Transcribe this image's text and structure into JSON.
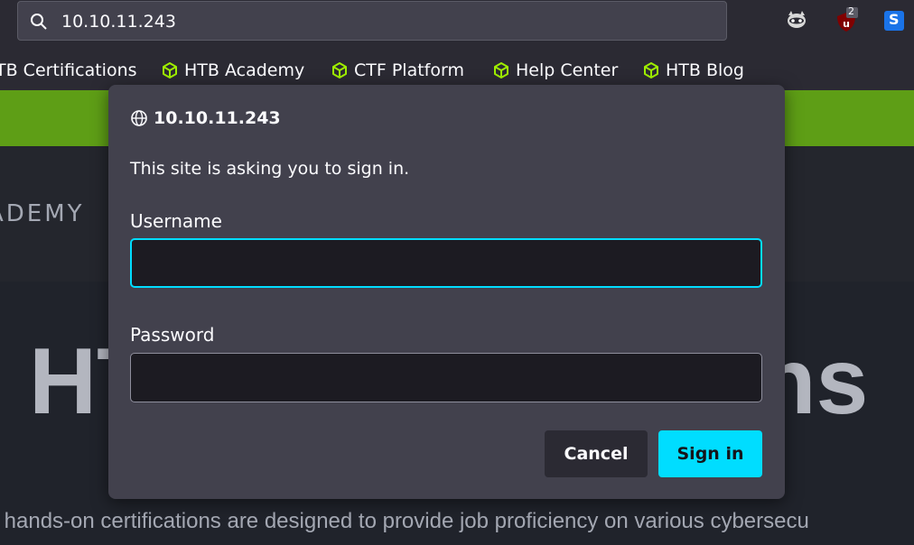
{
  "browser": {
    "url": "10.10.11.243",
    "extensions": [
      {
        "name": "raccoon-extension-icon"
      },
      {
        "name": "ublock-origin-icon",
        "badge": "2"
      },
      {
        "name": "s-extension-icon",
        "letter": "S"
      }
    ],
    "bookmarks": [
      "TB Certifications",
      "HTB Academy",
      "CTF Platform",
      "Help Center",
      "HTB Blog"
    ]
  },
  "page": {
    "nav_text": "ADEMY",
    "hero_title_left": "HT",
    "hero_title_right": "ns",
    "hero_subtitle": "s hands-on certifications are designed to provide job proficiency on various cybersecu",
    "colors": {
      "green_bar": "#5e9e16",
      "accent": "#00ddff"
    }
  },
  "dialog": {
    "origin": "10.10.11.243",
    "message": "This site is asking you to sign in.",
    "username_label": "Username",
    "username_value": "",
    "password_label": "Password",
    "password_value": "",
    "cancel_label": "Cancel",
    "signin_label": "Sign in"
  }
}
